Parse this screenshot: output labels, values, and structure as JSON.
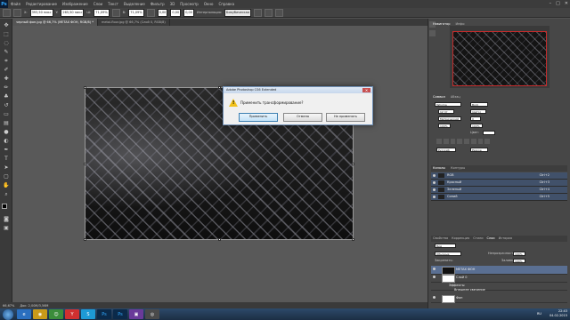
{
  "menubar": {
    "logo": "Ps",
    "items": [
      "Файл",
      "Редактирование",
      "Изображение",
      "Слои",
      "Текст",
      "Выделение",
      "Фильтр",
      "3D",
      "Просмотр",
      "Окно",
      "Справка"
    ],
    "window_buttons": [
      "–",
      "□",
      "✕"
    ]
  },
  "options": {
    "x_label": "X:",
    "x": "393,50 пикс",
    "y_label": "Y:",
    "y": "265,50 пикс",
    "w_label": "Ш:",
    "w": "71,09%",
    "h_label": "В:",
    "h": "71,09%",
    "angle": "0,00",
    "hskew": "0,00",
    "vskew": "0,00",
    "interp_label": "Интерполяция:",
    "interp": "Бикубическая"
  },
  "tabs": [
    {
      "label": "черный фон.jpg @ 66,7% (METAX ФОН, RGB/8) *",
      "active": true
    },
    {
      "label": "metal-floor.jpg @ 66,7% (Слой 0, RGB/8)",
      "active": false
    }
  ],
  "status": {
    "zoom": "66,67%",
    "doc": "Док: 2,00M/3,56M"
  },
  "dialog": {
    "title": "Adobe Photoshop CS6 Extended",
    "close": "✕",
    "message": "Применить трансформирование?",
    "apply": "Применить",
    "cancel": "Отмена",
    "dont_apply": "Не применять"
  },
  "panels": {
    "nav_tabs": [
      "Навигатор",
      "Инфо"
    ],
    "char_tabs": [
      "Символ",
      "Абзац"
    ],
    "font": "Tahoma",
    "style": "Bold",
    "size": "12 пт",
    "leading": "(Авто)",
    "tracking": "Метрический",
    "tracking_val": "0",
    "scale_v": "100%",
    "scale_h": "100%",
    "color_label": "Цвет:",
    "lang": "Русский",
    "aa": "Резкое",
    "channel_tabs": [
      "Каналы",
      "Контуры"
    ],
    "channels": [
      {
        "name": "RGB",
        "short": "Ctrl+2"
      },
      {
        "name": "Красный",
        "short": "Ctrl+3"
      },
      {
        "name": "Зеленый",
        "short": "Ctrl+4"
      },
      {
        "name": "Синий",
        "short": "Ctrl+5"
      }
    ],
    "layer_tabs": [
      "Свойства",
      "Коррекция",
      "Стили",
      "Слои",
      "История"
    ],
    "layer_kind": "Вид",
    "blend": "Обычные",
    "opacity_label": "Непрозрачность:",
    "opacity": "100%",
    "lock_label": "Закрепить:",
    "fill_label": "Заливка:",
    "fill": "100%",
    "layers": [
      {
        "name": "METAX ФОН"
      },
      {
        "name": "Слой 0"
      },
      {
        "name": "Эффекты"
      },
      {
        "name": "Внешнее свечение"
      },
      {
        "name": "Фон"
      }
    ]
  },
  "taskbar": {
    "apps": [
      "e",
      "◉",
      "☺",
      "Y",
      "S",
      "Ps",
      "Ps",
      "▣",
      "◎"
    ],
    "lang": "RU",
    "time": "22:43",
    "date": "04.02.2015"
  }
}
